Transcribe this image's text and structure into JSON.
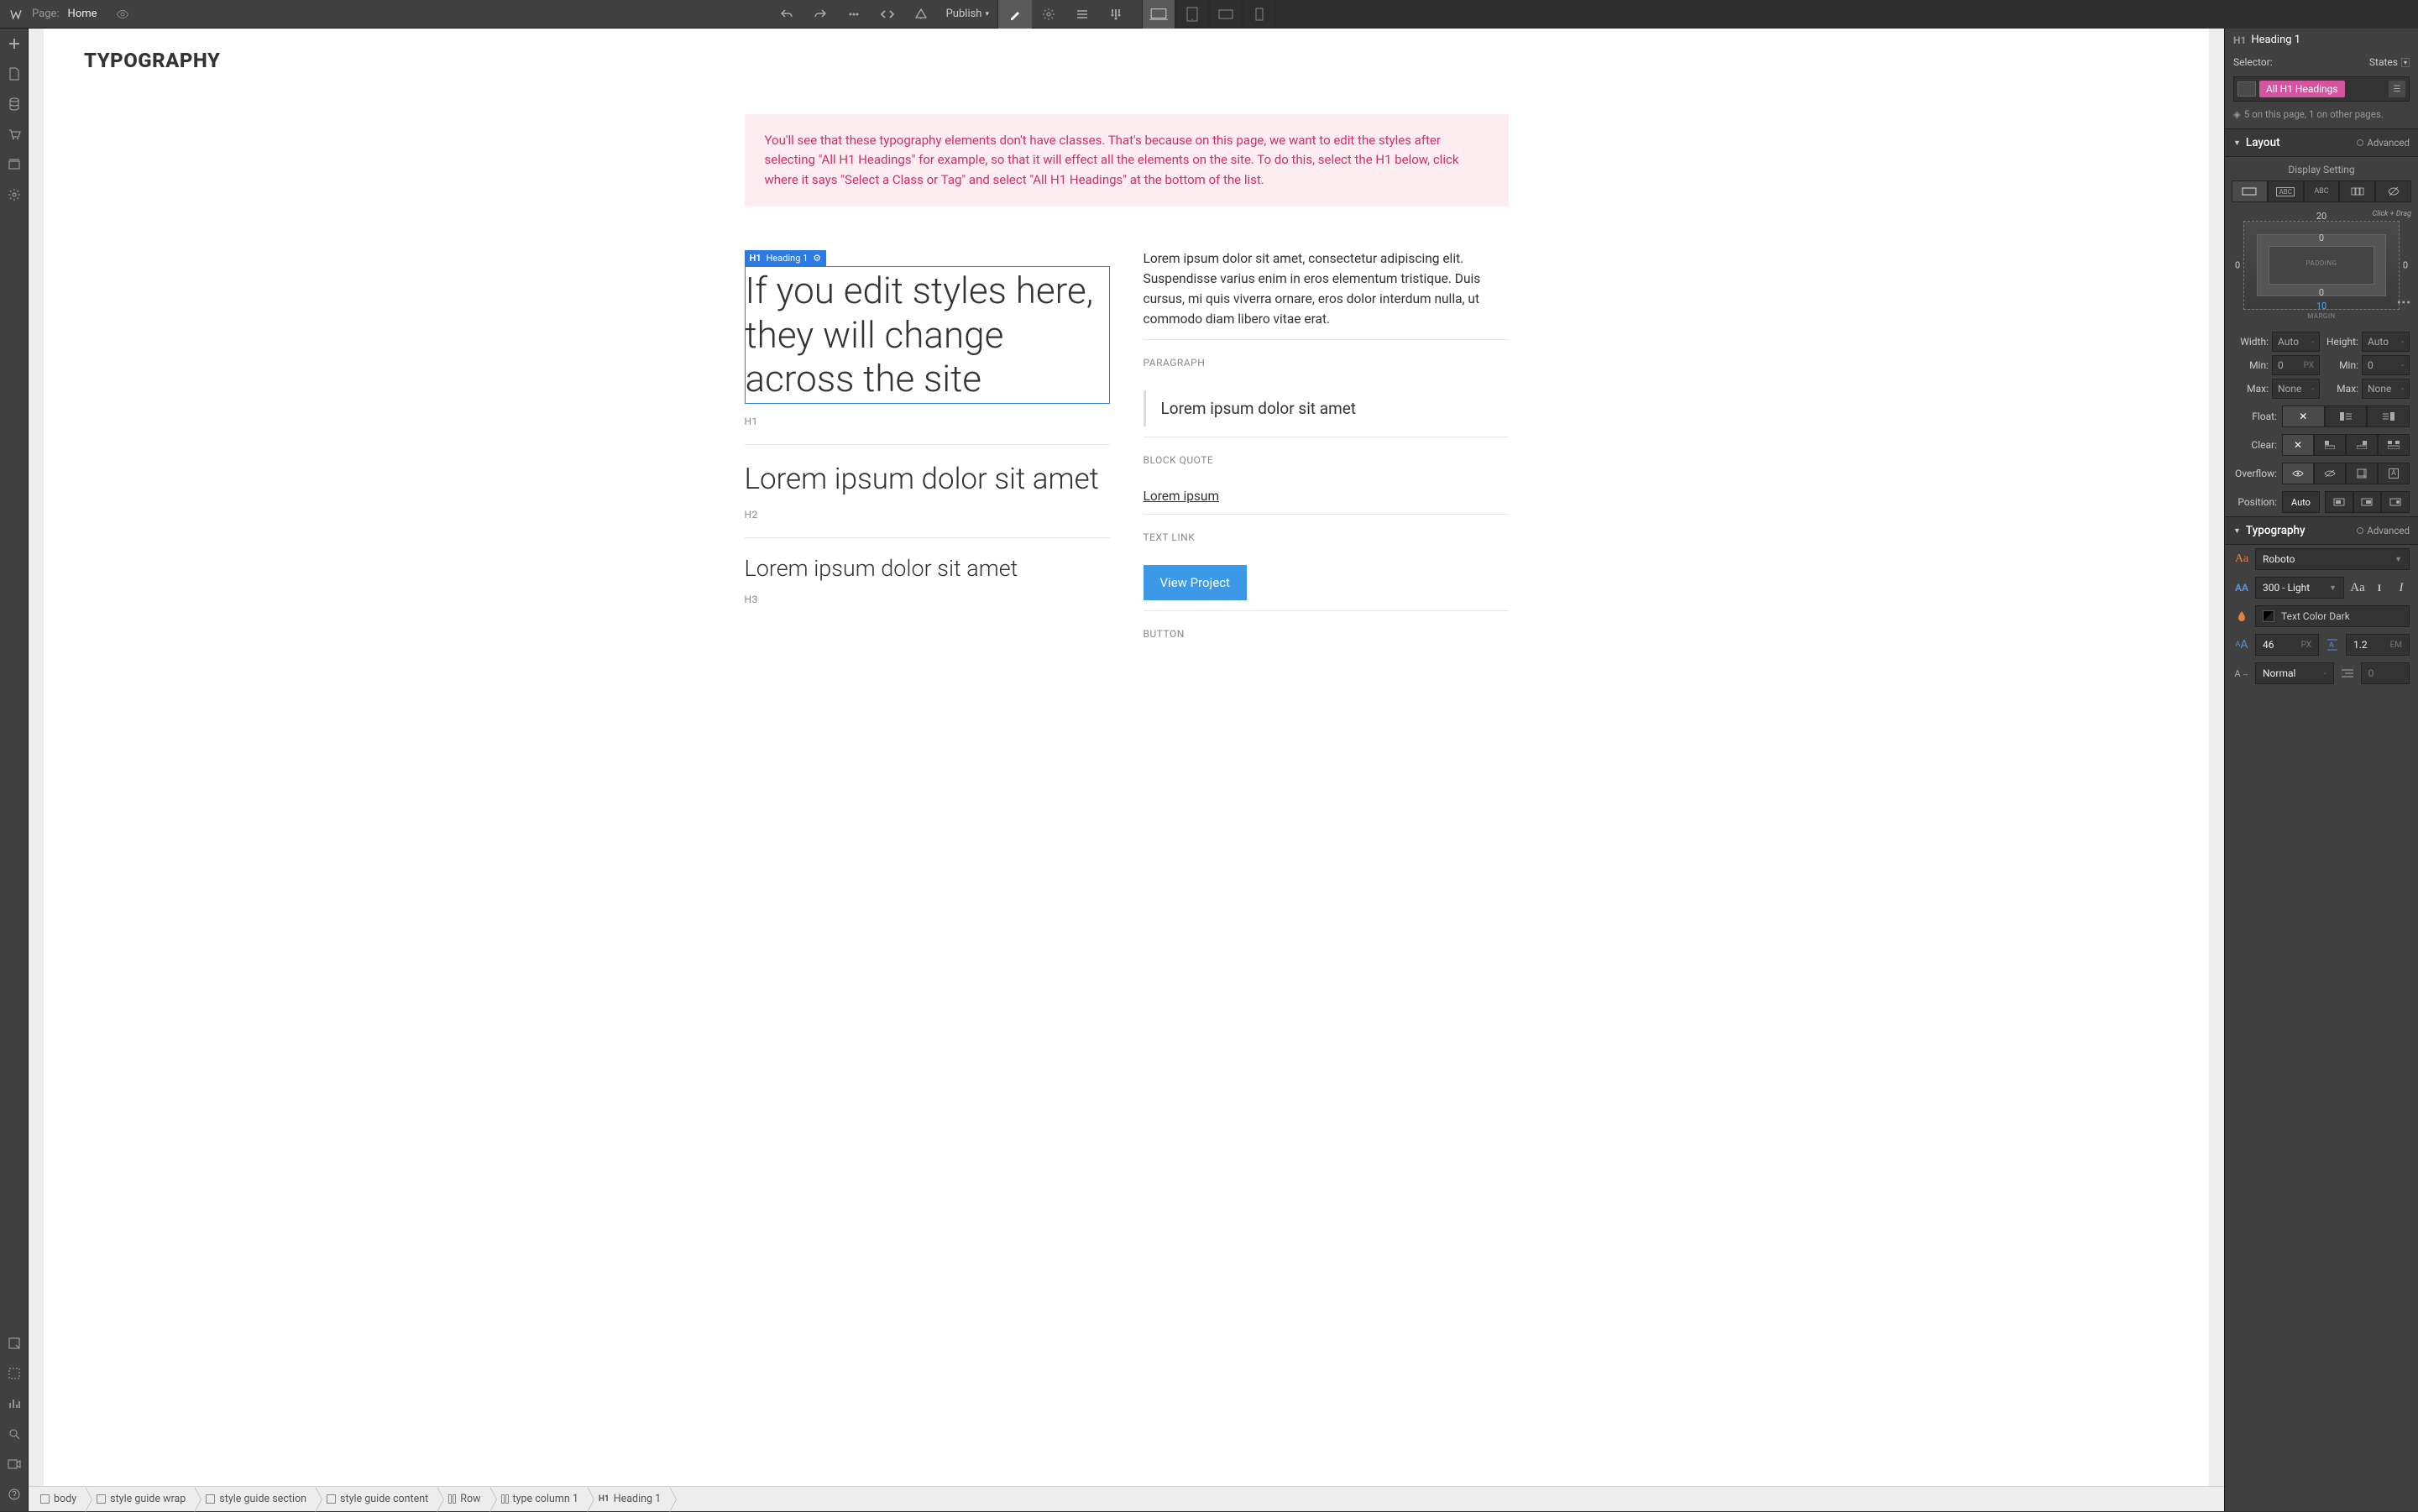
{
  "topbar": {
    "page_label": "Page:",
    "page_name": "Home",
    "publish": "Publish"
  },
  "canvas": {
    "title": "TYPOGRAPHY",
    "note": "You'll see that these typography elements don't have classes. That's because on this page, we want to edit the styles after selecting \"All H1 Headings\" for example, so that it will effect all the elements on the site. To do this, select the H1 below, click where it says \"Select a Class or Tag\" and select \"All H1 Headings\" at the bottom of the list.",
    "sel_tag_prefix": "H1",
    "sel_tag_label": "Heading 1",
    "h1_text": "If you edit styles here, they will change across the site",
    "label_h1": "H1",
    "h2_text": "Lorem ipsum dolor sit amet",
    "label_h2": "H2",
    "h3_text": "Lorem ipsum dolor sit amet",
    "label_h3": "H3",
    "para_text": "Lorem ipsum dolor sit amet, consectetur adipiscing elit. Suspendisse varius enim in eros elementum tristique. Duis cursus, mi quis viverra ornare, eros dolor interdum nulla, ut commodo diam libero vitae erat.",
    "label_paragraph": "PARAGRAPH",
    "bq_text": "Lorem ipsum dolor sit amet",
    "label_blockquote": "BLOCK QUOTE",
    "link_text": "Lorem ipsum",
    "label_link": "TEXT LINK",
    "button_text": "View Project",
    "label_button": "BUTTON"
  },
  "breadcrumb": [
    "body",
    "style guide wrap",
    "style guide section",
    "style guide content",
    "Row",
    "type column 1",
    "Heading 1"
  ],
  "breadcrumb_last_prefix": "H1",
  "right": {
    "el_tag": "H1",
    "el_name": "Heading 1",
    "selector_label": "Selector:",
    "states_label": "States",
    "tag": "All H1 Headings",
    "count": "5 on this page, 1 on other pages.",
    "sections": {
      "layout": "Layout",
      "typography": "Typography",
      "advanced": "Advanced"
    },
    "display_setting": "Display Setting",
    "box": {
      "top": "20",
      "inner_top": "0",
      "inner_bottom": "0",
      "left": "0",
      "right": "0",
      "bottom": "10",
      "pad_label": "PADDING",
      "mar_label": "MARGIN"
    },
    "click_drag": "Click + Drag",
    "dims": {
      "width_l": "Width:",
      "width_v": "Auto",
      "height_l": "Height:",
      "height_v": "Auto",
      "minw_l": "Min:",
      "minw_v": "0",
      "minw_u": "PX",
      "minh_l": "Min:",
      "minh_v": "0",
      "maxw_l": "Max:",
      "maxw_v": "None",
      "maxh_l": "Max:",
      "maxh_v": "None"
    },
    "float_l": "Float:",
    "clear_l": "Clear:",
    "overflow_l": "Overflow:",
    "position_l": "Position:",
    "position_v": "Auto",
    "typo": {
      "font": "Roboto",
      "weight": "300 - Light",
      "color_name": "Text Color Dark",
      "size": "46",
      "size_u": "PX",
      "line": "1.2",
      "line_u": "EM",
      "spacing": "Normal"
    }
  }
}
